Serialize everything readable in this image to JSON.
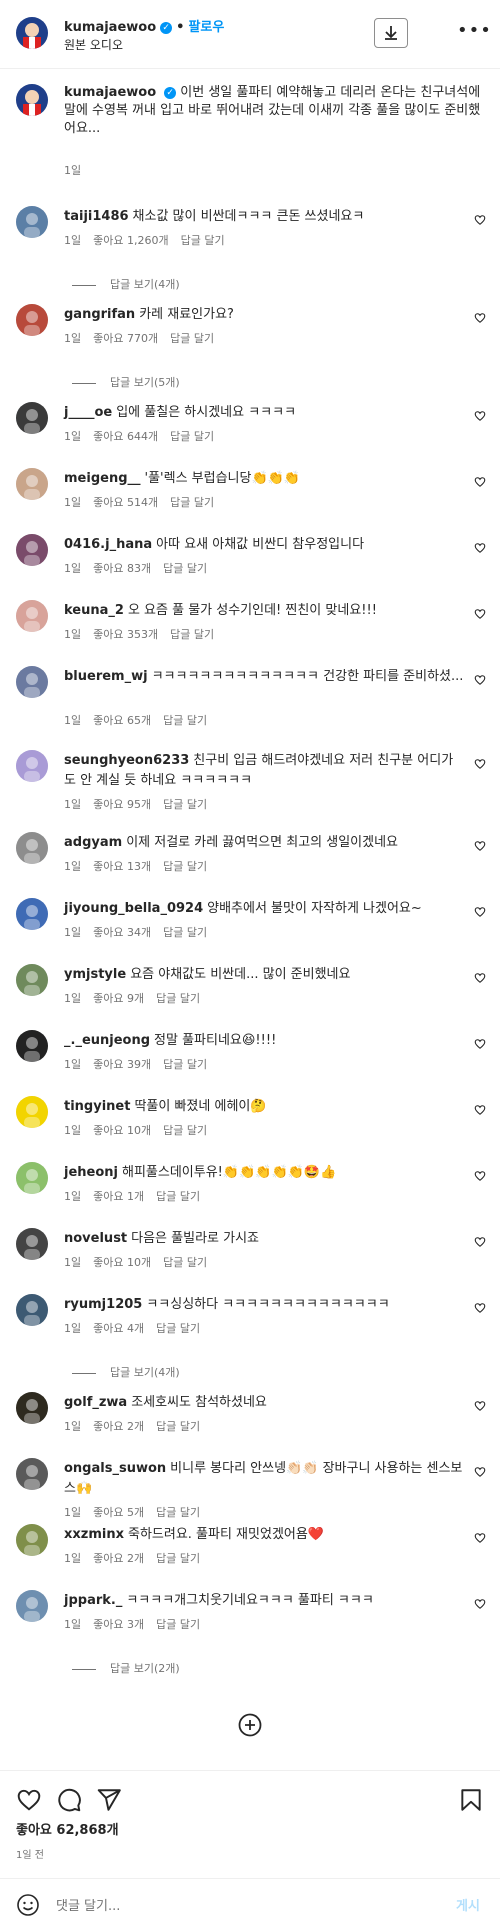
{
  "header": {
    "username": "kumajaewoo",
    "follow_label": "팔로우",
    "dot": "•",
    "subtitle": "원본 오디오"
  },
  "caption": {
    "username": "kumajaewoo",
    "text": "이번 생일 풀파티 예약해놓고 데리러 온다는 친구녀석에 말에 수영복 꺼내 입고 바로 뛰어내려 갔는데 이새끼 각종 풀을 많이도 준비했어요...",
    "time": "1일"
  },
  "labels": {
    "reply": "답글 달기",
    "like_prefix": "좋아요"
  },
  "comments": [
    {
      "user": "taiji1486",
      "text": "채소값 많이 비싼데ㅋㅋㅋ 큰돈 쓰셨네요ㅋ",
      "time": "1일",
      "likes": "좋아요 1,260개",
      "replies": "답글 보기(4개)",
      "color": "#5b7fa6"
    },
    {
      "user": "gangrifan",
      "text": "카레 재료인가요?",
      "time": "1일",
      "likes": "좋아요 770개",
      "replies": "답글 보기(5개)",
      "color": "#b84a3b"
    },
    {
      "user": "j____oe",
      "text": "입에 풀칠은 하시겠네요 ㅋㅋㅋㅋ",
      "time": "1일",
      "likes": "좋아요 644개",
      "replies": "",
      "color": "#3a3a3a"
    },
    {
      "user": "meigeng__",
      "text": "'풀'렉스 부럽습니당👏👏👏",
      "time": "1일",
      "likes": "좋아요 514개",
      "replies": "",
      "color": "#c9a58a"
    },
    {
      "user": "0416.j_hana",
      "text": "아따 요새 아채값 비싼디 참우정입니다",
      "time": "1일",
      "likes": "좋아요 83개",
      "replies": "",
      "color": "#7a4b6a"
    },
    {
      "user": "keuna_2",
      "text": "오 요즘 풀 물가 성수기인데! 찐친이 맞네요!!!",
      "time": "1일",
      "likes": "좋아요 353개",
      "replies": "",
      "color": "#d8a39a"
    },
    {
      "user": "bluerem_wj",
      "text": "ㅋㅋㅋㅋㅋㅋㅋㅋㅋㅋㅋㅋㅋㅋ 건강한 파티를 준비하셨...",
      "time": "1일",
      "likes": "좋아요 65개",
      "replies": "",
      "color": "#6b7aa0"
    },
    {
      "user": "seunghyeon6233",
      "text": "친구비 입금 해드려야겠네요 저러 친구분 어디가도 안 계실 듯 하네요 ㅋㅋㅋㅋㅋㅋ",
      "time": "1일",
      "likes": "좋아요 95개",
      "replies": "",
      "color": "#a99bd6"
    },
    {
      "user": "adgyam",
      "text": "이제 저걸로 카레 끓여먹으면 최고의 생일이겠네요",
      "time": "1일",
      "likes": "좋아요 13개",
      "replies": "",
      "color": "#8d8d8d"
    },
    {
      "user": "jiyoung_bella_0924",
      "text": "양배추에서 불맛이 자작하게 나겠어요~",
      "time": "1일",
      "likes": "좋아요 34개",
      "replies": "",
      "color": "#3f6bb5"
    },
    {
      "user": "ymjstyle",
      "text": "요즘 야채값도 비싼데... 많이 준비했네요",
      "time": "1일",
      "likes": "좋아요 9개",
      "replies": "",
      "color": "#6f8a5c"
    },
    {
      "user": "_._eunjeong",
      "text": "정말 풀파티네요😆!!!!",
      "time": "1일",
      "likes": "좋아요 39개",
      "replies": "",
      "color": "#222222"
    },
    {
      "user": "tingyinet",
      "text": "딱풀이 빠졌네 에헤이🤔",
      "time": "1일",
      "likes": "좋아요 10개",
      "replies": "",
      "color": "#f2d400"
    },
    {
      "user": "jeheonj",
      "text": "해피풀스데이투유!👏👏👏👏👏🤩👍",
      "time": "1일",
      "likes": "좋아요 1개",
      "replies": "",
      "color": "#8cc06a"
    },
    {
      "user": "novelust",
      "text": "다음은 풀빌라로 가시죠",
      "time": "1일",
      "likes": "좋아요 10개",
      "replies": "",
      "color": "#444444"
    },
    {
      "user": "ryumj1205",
      "text": "ㅋㅋ싱싱하다 ㅋㅋㅋㅋㅋㅋㅋㅋㅋㅋㅋㅋㅋㅋ",
      "time": "1일",
      "likes": "좋아요 4개",
      "replies": "답글 보기(4개)",
      "color": "#3d5a73"
    },
    {
      "user": "golf_zwa",
      "text": "조세호씨도 참석하셨네요",
      "time": "1일",
      "likes": "좋아요 2개",
      "replies": "",
      "color": "#2e2a1f"
    },
    {
      "user": "ongals_suwon",
      "text": "비니루 봉다리 안쓰넹👏🏻👏🏻 장바구니 사용하는 센스보스🙌",
      "time": "1일",
      "likes": "좋아요 5개",
      "replies": "",
      "color": "#5a5a5a"
    },
    {
      "user": "xxzminx",
      "text": "죽하드려요. 풀파티 재밋었겠어욤❤️",
      "time": "1일",
      "likes": "좋아요 2개",
      "replies": "",
      "color": "#7f8f4a"
    },
    {
      "user": "jppark._",
      "text": "ㅋㅋㅋㅋ개그치웃기네요ㅋㅋㅋ 풀파티 ㅋㅋㅋ",
      "time": "1일",
      "likes": "좋아요 3개",
      "replies": "답글 보기(2개)",
      "color": "#6e8fb0"
    }
  ],
  "footer": {
    "likes": "좋아요 62,868개",
    "time": "1일 전",
    "comment_placeholder": "댓글 달기...",
    "post_label": "게시"
  }
}
